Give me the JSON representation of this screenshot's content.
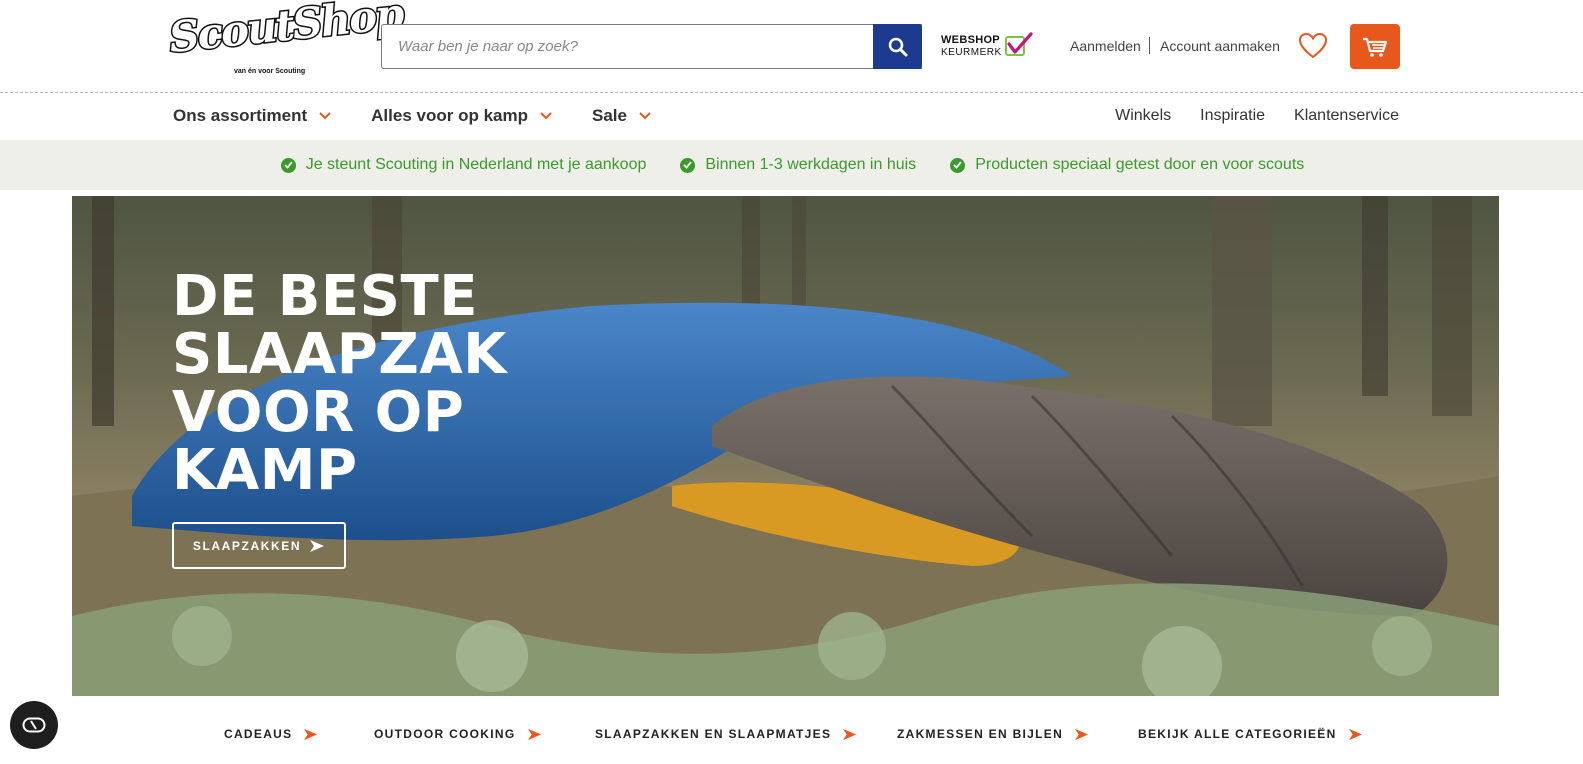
{
  "brand": {
    "logo_text": "ScoutShop",
    "tagline": "van én voor Scouting"
  },
  "search": {
    "placeholder": "Waar ben je naar op zoek?"
  },
  "trust_badge": {
    "line1": "WEBSHOP",
    "line2": "KEURMERK"
  },
  "account": {
    "login": "Aanmelden",
    "register": "Account aanmaken"
  },
  "nav": {
    "left": [
      {
        "label": "Ons assortiment"
      },
      {
        "label": "Alles voor op kamp"
      },
      {
        "label": "Sale"
      }
    ],
    "right": [
      {
        "label": "Winkels"
      },
      {
        "label": "Inspiratie"
      },
      {
        "label": "Klantenservice"
      }
    ]
  },
  "usps": [
    {
      "text": "Je steunt Scouting in Nederland met je aankoop"
    },
    {
      "text": "Binnen 1-3 werkdagen in huis"
    },
    {
      "text": "Producten speciaal getest door en voor scouts"
    }
  ],
  "hero": {
    "title": "DE BESTE SLAAPZAK VOOR OP KAMP",
    "button": "SLAAPZAKKEN"
  },
  "categories": [
    {
      "label": "CADEAUS"
    },
    {
      "label": "OUTDOOR COOKING"
    },
    {
      "label": "SLAAPZAKKEN EN SLAAPMATJES"
    },
    {
      "label": "ZAKMESSEN EN BIJLEN"
    },
    {
      "label": "BEKIJK ALLE CATEGORIEËN"
    }
  ],
  "colors": {
    "accent": "#e8571c",
    "search_button": "#1c3a8f",
    "usp_green": "#3a9a2c",
    "usp_bar_bg": "#efefea"
  },
  "icons": {
    "search": "search-icon",
    "wishlist": "heart-icon",
    "cart": "cart-icon",
    "chevron": "chevron-down-icon",
    "check": "check-circle-icon",
    "arrow": "arrow-right-icon",
    "accessibility": "accessibility-icon"
  }
}
